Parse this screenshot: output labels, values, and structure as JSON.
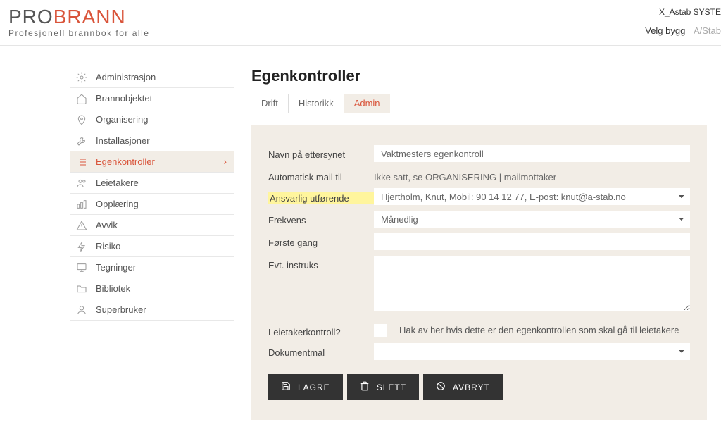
{
  "header": {
    "logo_pro": "PRO",
    "logo_brann": "BRANN",
    "tagline": "Profesjonell brannbok for alle",
    "system_tag": "X_Astab SYSTE",
    "velg_bygg": "Velg bygg",
    "bygg_sub": "A/Stab"
  },
  "sidebar": {
    "items": [
      {
        "label": "Administrasjon",
        "icon": "gear-icon"
      },
      {
        "label": "Brannobjektet",
        "icon": "home-icon"
      },
      {
        "label": "Organisering",
        "icon": "pin-icon"
      },
      {
        "label": "Installasjoner",
        "icon": "wrench-icon"
      },
      {
        "label": "Egenkontroller",
        "icon": "checklist-icon"
      },
      {
        "label": "Leietakere",
        "icon": "people-icon"
      },
      {
        "label": "Opplæring",
        "icon": "graph-icon"
      },
      {
        "label": "Avvik",
        "icon": "warning-icon"
      },
      {
        "label": "Risiko",
        "icon": "bolt-icon"
      },
      {
        "label": "Tegninger",
        "icon": "screen-icon"
      },
      {
        "label": "Bibliotek",
        "icon": "folder-icon"
      },
      {
        "label": "Superbruker",
        "icon": "user-icon"
      }
    ]
  },
  "page": {
    "title": "Egenkontroller",
    "tabs": [
      {
        "label": "Drift"
      },
      {
        "label": "Historikk"
      },
      {
        "label": "Admin"
      }
    ],
    "form": {
      "navn_label": "Navn på ettersynet",
      "navn_value": "Vaktmesters egenkontroll",
      "mail_label": "Automatisk mail til",
      "mail_value": "Ikke satt, se ORGANISERING | mailmottaker",
      "ansvarlig_label": "Ansvarlig utførende",
      "ansvarlig_value": "Hjertholm, Knut, Mobil: 90 14 12 77, E-post: knut@a-stab.no",
      "frekvens_label": "Frekvens",
      "frekvens_value": "Månedlig",
      "forste_label": "Første gang",
      "forste_value": "",
      "instruks_label": "Evt. instruks",
      "instruks_value": "",
      "leietaker_label": "Leietakerkontroll?",
      "leietaker_help": "Hak av her hvis dette er den egenkontrollen som skal gå til leietakere",
      "dokumentmal_label": "Dokumentmal",
      "dokumentmal_value": "",
      "lagre": "LAGRE",
      "slett": "SLETT",
      "avbryt": "AVBRYT"
    }
  }
}
